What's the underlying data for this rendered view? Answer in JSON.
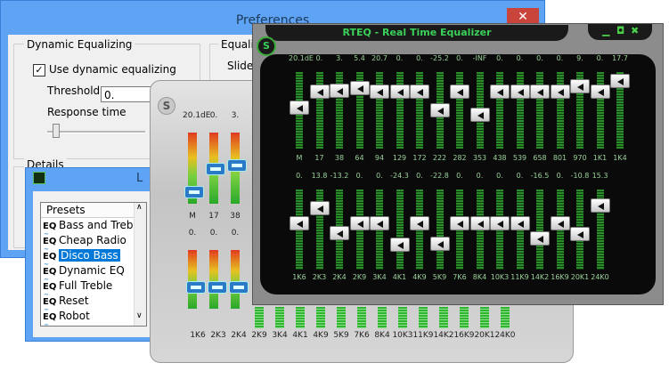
{
  "preferences": {
    "title": "Preferences",
    "close_glyph": "✕",
    "dynamic_group_label": "Dynamic Equalizing",
    "use_dynamic_label": "Use dynamic equalizing",
    "use_dynamic_checked": true,
    "threshold_label": "Threshold",
    "threshold_value": "0.",
    "response_label": "Response time",
    "equaliz_group_label": "Equaliz",
    "slider_label": "Slider",
    "details_label": "Details"
  },
  "presets": {
    "title": "L",
    "list_header": "Presets",
    "icon_text": "EQ",
    "icon_sub": "~",
    "items": [
      "Bass and Treble",
      "Cheap Radio",
      "Disco Bass",
      "Dynamic EQ",
      "Full Treble",
      "Reset",
      "Robot"
    ],
    "selected": "Disco Bass",
    "scroll_up": "∧",
    "scroll_down": "∨"
  },
  "silver_eq": {
    "badge": "S",
    "top_values": [
      "20.1dE",
      "0.",
      "3."
    ],
    "top_labels": [
      "M",
      "17",
      "38"
    ],
    "bottom_values": [
      "0.",
      "0.",
      "0."
    ],
    "bottom_labels": [
      "1K6",
      "2K3",
      "2K4",
      "2K9",
      "3K4",
      "4K1",
      "4K9",
      "5K9",
      "7K6",
      "8K4",
      "10K3",
      "11K9",
      "14K2",
      "16K9",
      "20K1",
      "24K0"
    ]
  },
  "rteq": {
    "title": "RTEQ - Real Time Equalizer",
    "badge": "S",
    "btn_minimize": "▁",
    "btn_maximize": "◘",
    "btn_close": "✖",
    "row1": {
      "values": [
        "20.1dE",
        "0.",
        "3.",
        "5.4",
        "20.7",
        "0.",
        "0.",
        "-25.2",
        "0.",
        "-INF",
        "0.",
        "0.",
        "0.",
        "0.",
        "9.",
        "0.",
        "17.7"
      ],
      "labels": [
        "M",
        "17",
        "38",
        "64",
        "94",
        "129",
        "172",
        "222",
        "282",
        "353",
        "438",
        "539",
        "658",
        "801",
        "970",
        "1K1",
        "1K4"
      ],
      "levels": [
        0.55,
        0.8,
        0.81,
        0.86,
        0.8,
        0.8,
        0.8,
        0.5,
        0.8,
        0.43,
        0.8,
        0.8,
        0.8,
        0.8,
        0.88,
        0.8,
        0.97
      ]
    },
    "row2": {
      "values": [
        "0.",
        "13.8",
        "-13.2",
        "0.",
        "0.",
        "-24.3",
        "0.",
        "-22.8",
        "0.",
        "0.",
        "0.",
        "0.",
        "-16.5",
        "0.",
        "-10.8",
        "15.3"
      ],
      "labels": [
        "1K6",
        "2K3",
        "2K4",
        "2K9",
        "3K4",
        "4K1",
        "4K9",
        "5K9",
        "7K6",
        "8K4",
        "10K3",
        "11K9",
        "14K2",
        "16K9",
        "20K1",
        "24K0"
      ],
      "levels": [
        0.6,
        0.83,
        0.44,
        0.6,
        0.6,
        0.27,
        0.6,
        0.29,
        0.6,
        0.6,
        0.6,
        0.6,
        0.36,
        0.6,
        0.43,
        0.86
      ]
    }
  }
}
